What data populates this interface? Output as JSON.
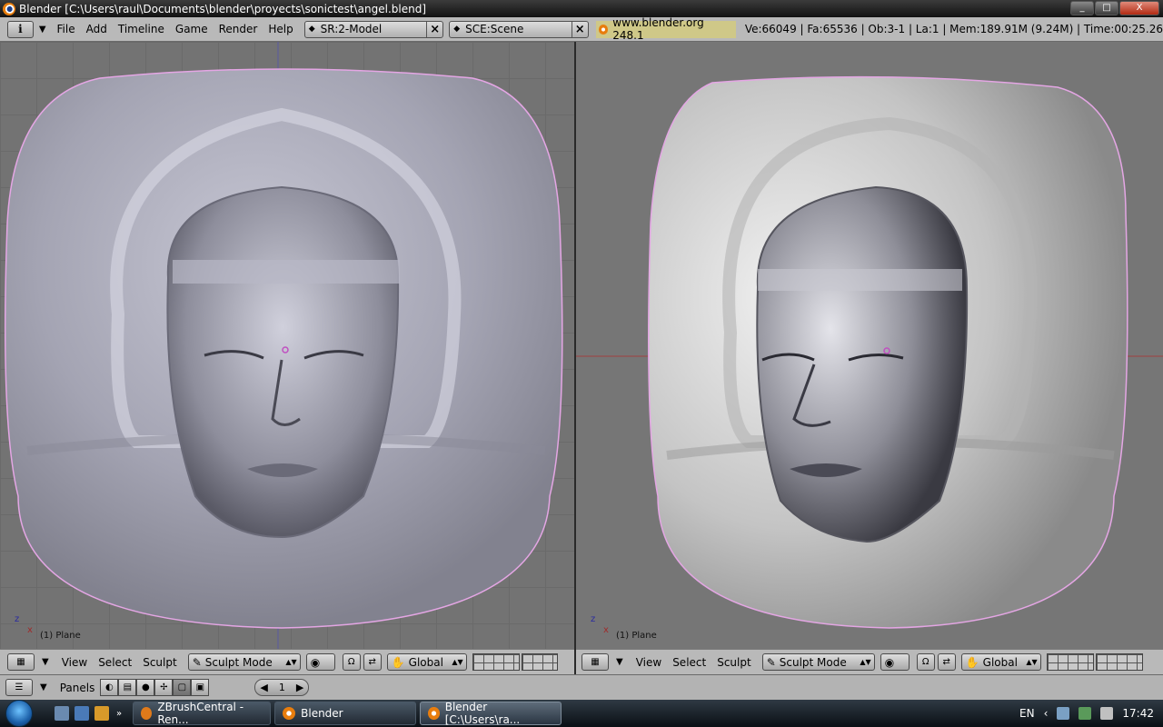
{
  "window": {
    "title": "Blender [C:\\Users\\raul\\Documents\\blender\\proyects\\sonictest\\angel.blend]",
    "controls": [
      "_",
      "□",
      "X"
    ]
  },
  "header": {
    "menus": [
      "File",
      "Add",
      "Timeline",
      "Game",
      "Render",
      "Help"
    ],
    "screen_field": "SR:2-Model",
    "scene_field": "SCE:Scene",
    "url": "www.blender.org 248.1",
    "stats": "Ve:66049 | Fa:65536 | Ob:3-1 | La:1  | Mem:189.91M (9.24M) | Time:00:25.26"
  },
  "viewports": [
    {
      "axis_z": "z",
      "axis_x": "x",
      "object_label": "(1) Plane",
      "menus": [
        "View",
        "Select",
        "Sculpt"
      ],
      "mode": "Sculpt Mode",
      "orientation": "Global"
    },
    {
      "axis_z": "z",
      "axis_x": "x",
      "object_label": "(1) Plane",
      "menus": [
        "View",
        "Select",
        "Sculpt"
      ],
      "mode": "Sculpt Mode",
      "orientation": "Global"
    }
  ],
  "panels_bar": {
    "label": "Panels",
    "frame": "1"
  },
  "taskbar": {
    "tasks": [
      "ZBrushCentral - Ren...",
      "Blender",
      "Blender [C:\\Users\\ra..."
    ],
    "language": "EN",
    "clock": "17:42"
  },
  "colors": {
    "viewport_bg": "#737373",
    "header_bg": "#b9b9b9",
    "mesh": "#a9a9b8",
    "outline": "#e6a8e6"
  }
}
